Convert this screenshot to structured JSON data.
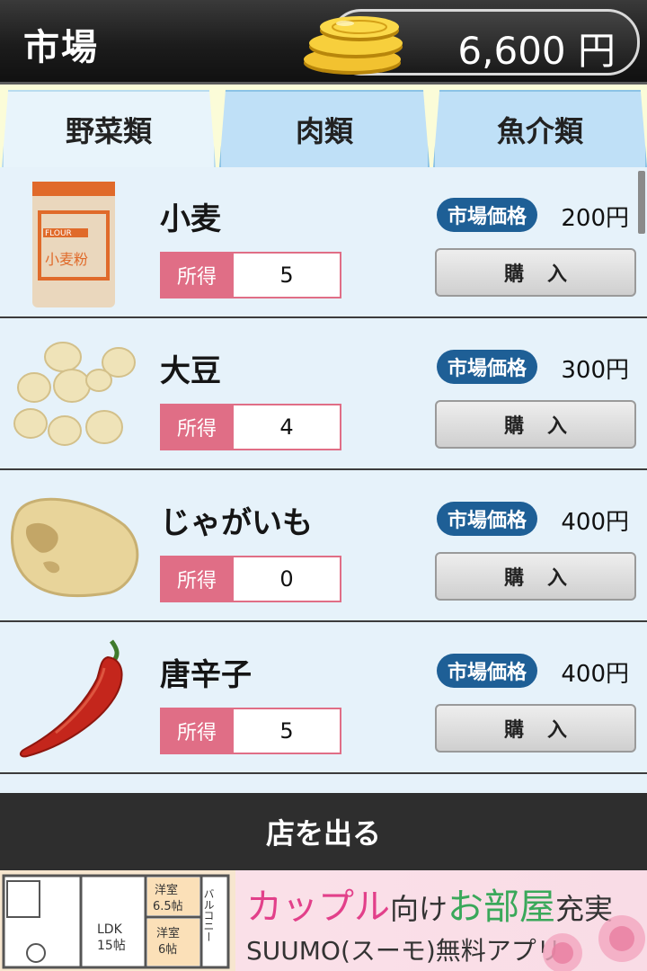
{
  "header": {
    "title": "市場",
    "money": "6,600 円"
  },
  "tabs": [
    {
      "label": "野菜類",
      "active": true
    },
    {
      "label": "肉類",
      "active": false
    },
    {
      "label": "魚介類",
      "active": false
    }
  ],
  "items": [
    {
      "name": "小麦",
      "image": "flour-bag-icon",
      "owned_label": "所得",
      "owned": "5",
      "price_label": "市場価格",
      "price": "200円",
      "buy_label": "購入",
      "flour_text": "FLOUR",
      "flour_text_jp": "小麦粉"
    },
    {
      "name": "大豆",
      "image": "soybeans-icon",
      "owned_label": "所得",
      "owned": "4",
      "price_label": "市場価格",
      "price": "300円",
      "buy_label": "購入"
    },
    {
      "name": "じゃがいも",
      "image": "potato-icon",
      "owned_label": "所得",
      "owned": "0",
      "price_label": "市場価格",
      "price": "400円",
      "buy_label": "購入"
    },
    {
      "name": "唐辛子",
      "image": "chili-pepper-icon",
      "owned_label": "所得",
      "owned": "5",
      "price_label": "市場価格",
      "price": "400円",
      "buy_label": "購入"
    }
  ],
  "exit_label": "店を出る",
  "ad": {
    "plan_labels": [
      "洋室",
      "6.5帖",
      "LDK",
      "15帖",
      "洋室",
      "6帖",
      "バルコニー"
    ],
    "headline_part1": "カップル",
    "headline_part2": "向け",
    "headline_part3": "お部屋",
    "headline_part4": "充実",
    "sub": "SUUMO(スーモ)無料アプリ"
  },
  "colors": {
    "accent_badge": "#1e5f96",
    "owned_label": "#e06e86",
    "list_bg": "#e6f2fa",
    "tab_bg": "#bfe0f7"
  }
}
